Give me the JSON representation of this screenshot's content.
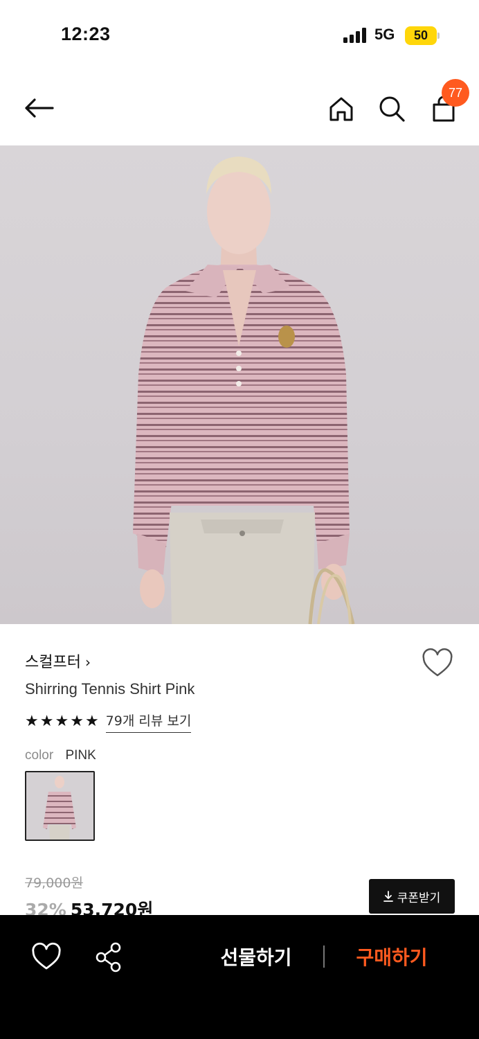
{
  "status_bar": {
    "time": "12:23",
    "network": "5G",
    "battery": "50"
  },
  "nav": {
    "cart_count": "77"
  },
  "product": {
    "brand": "스컬프터",
    "brand_chevron": "›",
    "name": "Shirring Tennis Shirt Pink",
    "rating_stars": 5,
    "review_link": "79개 리뷰 보기",
    "color_label": "color",
    "color_value": "PINK",
    "original_price": "79,000원",
    "discount": "32%",
    "sale_price": "53,720원",
    "coupon_button": "쿠폰받기"
  },
  "bottom_bar": {
    "gift_label": "선물하기",
    "buy_label": "구매하기"
  },
  "colors": {
    "accent": "#ff5a1f",
    "battery": "#ffd60a",
    "bottom_bar": "#000000"
  },
  "icons": {
    "back": "back-arrow-icon",
    "home": "home-icon",
    "search": "search-icon",
    "cart": "shopping-bag-icon",
    "wishlist": "heart-icon",
    "share": "share-icon",
    "coupon": "download-icon",
    "star": "star-icon"
  }
}
